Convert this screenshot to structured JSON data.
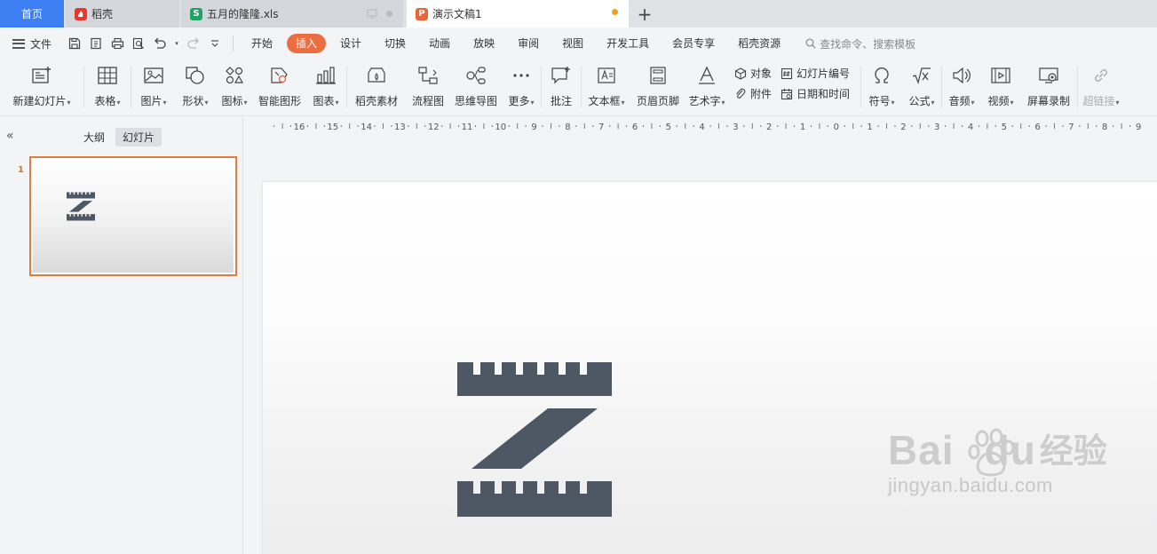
{
  "tabs": {
    "home": "首页",
    "docer": "稻壳",
    "sheet": "五月的隆隆.xls",
    "presentation": "演示文稿1",
    "new_tab": "+"
  },
  "menu": {
    "file": "文件",
    "tabs": [
      "开始",
      "插入",
      "设计",
      "切换",
      "动画",
      "放映",
      "审阅",
      "视图",
      "开发工具",
      "会员专享",
      "稻壳资源"
    ],
    "active_tab": "插入",
    "search_placeholder": "查找命令、搜索模板"
  },
  "ribbon": {
    "new_slide": "新建幻灯片",
    "table": "表格",
    "picture": "图片",
    "shape": "形状",
    "icon": "图标",
    "smartart": "智能图形",
    "chart": "图表",
    "docer_material": "稻壳素材",
    "flowchart": "流程图",
    "mindmap": "思维导图",
    "more": "更多",
    "comment": "批注",
    "textbox": "文本框",
    "header_footer": "页眉页脚",
    "wordart": "艺术字",
    "object": "对象",
    "attachment": "附件",
    "slide_number": "幻灯片编号",
    "date_time": "日期和时间",
    "symbol": "符号",
    "formula": "公式",
    "audio": "音频",
    "video": "视频",
    "screen_record": "屏幕录制",
    "hyperlink": "超链接"
  },
  "left_panel": {
    "outline_tab": "大纲",
    "slides_tab": "幻灯片",
    "slide_number": "1"
  },
  "ruler": {
    "labels": [
      "16",
      "15",
      "14",
      "13",
      "12",
      "11",
      "10",
      "9",
      "8",
      "7",
      "6",
      "5",
      "4",
      "3",
      "2",
      "1",
      "0",
      "1",
      "2",
      "3",
      "4",
      "5",
      "6",
      "7",
      "8",
      "9"
    ]
  },
  "watermark": {
    "brand": "Bai",
    "brand2": "du",
    "cn": "经验",
    "url": "jingyan.baidu.com"
  },
  "colors": {
    "accent": "#ec6e40",
    "home_tab": "#3d7ef3",
    "logo": "#4e5865"
  }
}
